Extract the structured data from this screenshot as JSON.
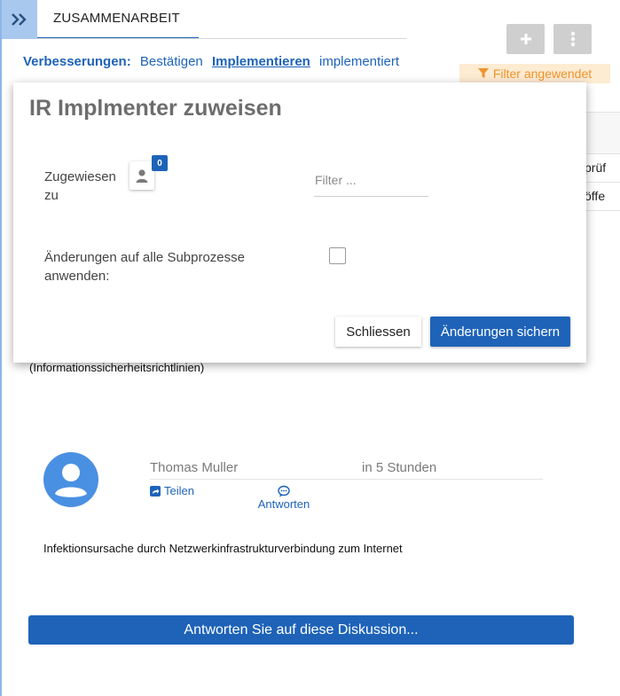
{
  "header": {
    "tab_label": "ZUSAMMENARBEIT",
    "expand_icon": "double-chevron-right-icon",
    "add_icon": "plus-icon",
    "more_icon": "vertical-dots-icon"
  },
  "subnav": {
    "label": "Verbesserungen:",
    "links": [
      "Bestätigen",
      "Implementieren",
      "implementiert"
    ],
    "active": "Implementieren"
  },
  "filter_badge": {
    "label": "Filter angewendet",
    "icon": "funnel-icon",
    "color": "#f0942b"
  },
  "background_table": {
    "cells": [
      "prüf",
      "öffe"
    ]
  },
  "modal": {
    "title": "IR Implmenter zuweisen",
    "assigned_label": "Zugewiesen zu",
    "assigned_count": "0",
    "filter_placeholder": "Filter ...",
    "filter_value": "",
    "subprocess_label": "Änderungen auf alle Subprozesse anwenden:",
    "subprocess_checked": false,
    "close_label": "Schliessen",
    "save_label": "Änderungen sichern"
  },
  "discussion": {
    "orphan_text": "(Informationssicherheitsrichtlinien)",
    "author": "Thomas Muller",
    "time": "in 5 Stunden",
    "share_label": "Teilen",
    "reply_label": "Antworten",
    "comment": "Infektionsursache durch Netzwerkinfrastrukturverbindung zum Internet",
    "reply_bar_label": "Antworten Sie auf diese Diskussion..."
  },
  "colors": {
    "primary": "#1e63b8",
    "expand_bg": "#a9c8ee",
    "avatar": "#4a90e2",
    "filter_bg": "#fdebd2"
  }
}
